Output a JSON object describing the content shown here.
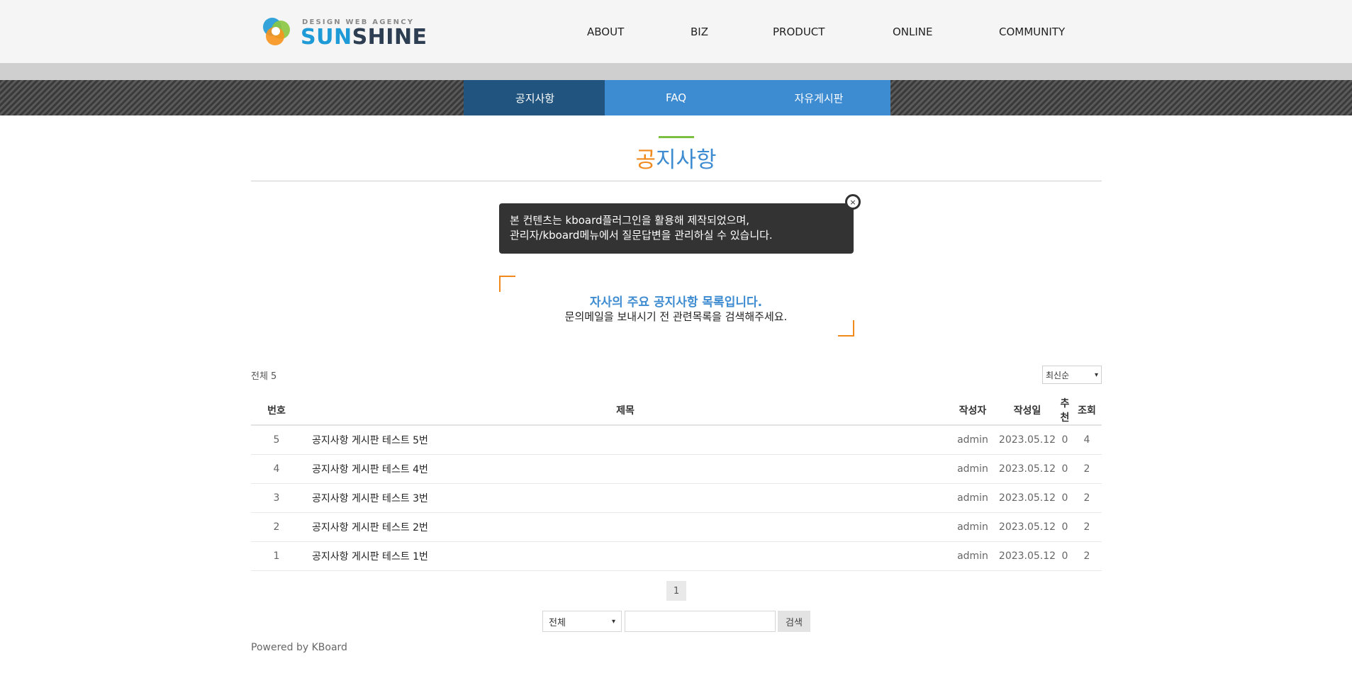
{
  "header": {
    "logo_tagline": "DESIGN WEB AGENCY",
    "logo_sun": "SUN",
    "logo_shine": "SHINE",
    "nav": [
      "ABOUT",
      "BIZ",
      "PRODUCT",
      "ONLINE",
      "COMMUNITY"
    ]
  },
  "subnav": {
    "tabs": [
      "공지사항",
      "FAQ",
      "자유게시판"
    ],
    "active": "공지사항"
  },
  "page": {
    "title_first": "공",
    "title_rest": "지사항"
  },
  "notice": {
    "line1": "본 컨텐츠는 kboard플러그인을 활용해 제작되었으며,",
    "line2": "관리자/kboard메뉴에서 질문답변을 관리하실 수 있습니다.",
    "close": "×"
  },
  "intro": {
    "main": "자사의 주요 공지사항 목록입니다.",
    "sub": "문의메일을 보내시기 전 관련목록을 검색해주세요."
  },
  "board": {
    "total_label": "전체 5",
    "sort_value": "최신순",
    "columns": [
      "번호",
      "제목",
      "작성자",
      "작성일",
      "추천",
      "조회"
    ],
    "rows": [
      {
        "no": "5",
        "title": "공지사항 게시판 테스트 5번",
        "author": "admin",
        "date": "2023.05.12",
        "votes": "0",
        "views": "4"
      },
      {
        "no": "4",
        "title": "공지사항 게시판 테스트 4번",
        "author": "admin",
        "date": "2023.05.12",
        "votes": "0",
        "views": "2"
      },
      {
        "no": "3",
        "title": "공지사항 게시판 테스트 3번",
        "author": "admin",
        "date": "2023.05.12",
        "votes": "0",
        "views": "2"
      },
      {
        "no": "2",
        "title": "공지사항 게시판 테스트 2번",
        "author": "admin",
        "date": "2023.05.12",
        "votes": "0",
        "views": "2"
      },
      {
        "no": "1",
        "title": "공지사항 게시판 테스트 1번",
        "author": "admin",
        "date": "2023.05.12",
        "votes": "0",
        "views": "2"
      }
    ],
    "page": "1",
    "search_scope": "전체",
    "search_value": "",
    "search_button": "검색"
  },
  "footer": {
    "powered": "Powered by KBoard"
  },
  "colors": {
    "accent_blue": "#3d8bd1",
    "active_tab": "#21557f",
    "accent_orange": "#f08a1c",
    "accent_green": "#7bc043"
  }
}
